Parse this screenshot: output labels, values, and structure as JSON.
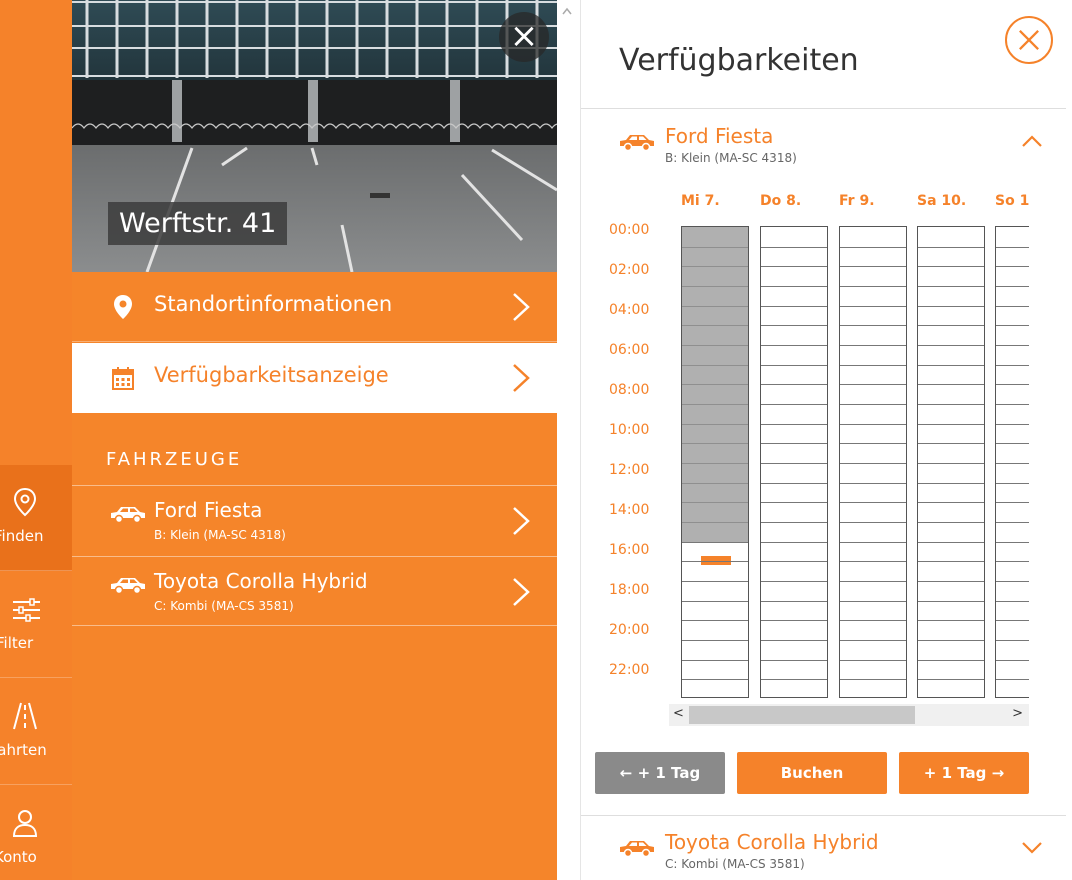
{
  "rail": {
    "items": [
      {
        "label": "Finden",
        "icon": "location-pin-icon",
        "active": true
      },
      {
        "label": "Filter",
        "icon": "sliders-icon",
        "active": false
      },
      {
        "label": "Fahrten",
        "icon": "road-icon",
        "active": false
      },
      {
        "label": "Konto",
        "icon": "user-icon",
        "active": false
      }
    ]
  },
  "location": {
    "title": "Werftstr. 41",
    "close_glyph": "×"
  },
  "menu": {
    "items": [
      {
        "label": "Standortinformationen",
        "icon": "map-marker-icon"
      },
      {
        "label": "Verfügbarkeitsanzeige",
        "icon": "calendar-icon"
      }
    ]
  },
  "vehicles": {
    "heading": "FAHRZEUGE",
    "items": [
      {
        "name": "Ford Fiesta",
        "sub": "B: Klein (MA-SC 4318)"
      },
      {
        "name": "Toyota Corolla Hybrid",
        "sub": "C: Kombi (MA-CS 3581)"
      }
    ]
  },
  "availability": {
    "title": "Verfügbarkeiten",
    "expanded_vehicle": {
      "name": "Ford Fiesta",
      "sub": "B: Klein (MA-SC 4318)"
    },
    "collapsed_vehicle": {
      "name": "Toyota Corolla Hybrid",
      "sub": "C: Kombi (MA-CS 3581)"
    },
    "days": [
      "Mi 7.",
      "Do 8.",
      "Fr 9.",
      "Sa 10.",
      "So 1"
    ],
    "times": [
      "00:00",
      "02:00",
      "04:00",
      "06:00",
      "08:00",
      "10:00",
      "12:00",
      "14:00",
      "16:00",
      "18:00",
      "20:00",
      "22:00"
    ],
    "booked_until_hour": 16,
    "marker_hour": 16.75,
    "buttons": {
      "prev": "← + 1 Tag",
      "book": "Buchen",
      "next": "+ 1 Tag →"
    },
    "scroll_left": "<",
    "scroll_right": ">"
  },
  "colors": {
    "accent": "#f5822a",
    "busy": "#b0b0b0",
    "grey_button": "#8a8a8a"
  }
}
